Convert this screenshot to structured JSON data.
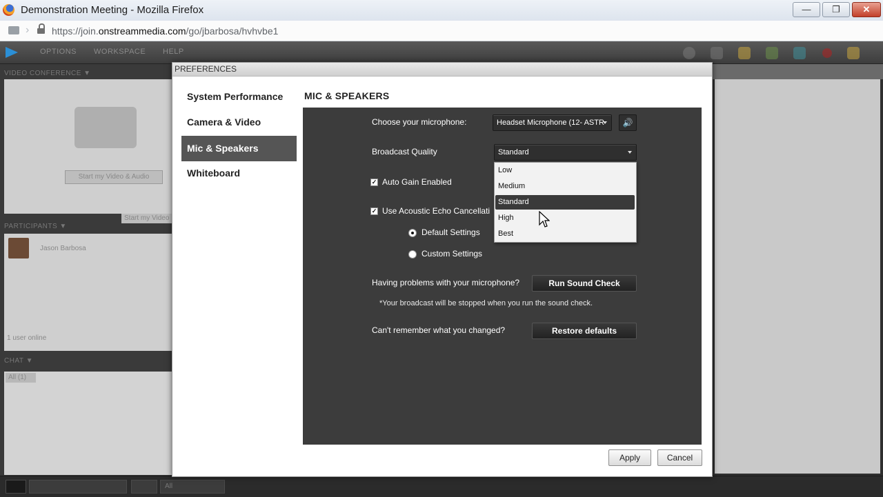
{
  "browser": {
    "window_title": "Demonstration Meeting - Mozilla Firefox",
    "url_prefix": "https://join.",
    "url_domain": "onstreammedia.com",
    "url_path": "/go/jbarbosa/hvhvbe1",
    "minimize_label": "—",
    "restore_label": "❐",
    "close_label": "✕"
  },
  "app": {
    "menu": [
      "OPTIONS",
      "WORKSPACE",
      "HELP"
    ],
    "video_conference_label": "VIDEO CONFERENCE ▼",
    "start_video_label": "Start my Video & Audio",
    "start_video_secondary": "Start my Video",
    "participants_label": "PARTICIPANTS ▼",
    "participant_name": "Jason Barbosa",
    "users_online": "1 user online",
    "chat_label": "CHAT ▼",
    "chat_tab": "All (1)",
    "bottom_select": "All"
  },
  "dialog": {
    "title": "PREFERENCES",
    "nav": [
      {
        "label": "System Performance"
      },
      {
        "label": "Camera & Video"
      },
      {
        "label": "Mic & Speakers"
      },
      {
        "label": "Whiteboard"
      }
    ],
    "active_nav": "Mic & Speakers",
    "section_title": "MIC & SPEAKERS",
    "microphone": {
      "label": "Choose your microphone:",
      "value": "Headset Microphone (12- ASTR"
    },
    "broadcast_quality": {
      "label": "Broadcast Quality",
      "value": "Standard",
      "options": [
        "Low",
        "Medium",
        "Standard",
        "High",
        "Best"
      ],
      "selected": "Standard"
    },
    "auto_gain": {
      "label": "Auto Gain Enabled",
      "checked": true
    },
    "echo_cancel": {
      "label": "Use Acoustic Echo Cancellati",
      "checked": true
    },
    "echo_settings": {
      "default_label": "Default Settings",
      "custom_label": "Custom Settings",
      "selected": "Default Settings"
    },
    "sound_check": {
      "question": "Having problems with your microphone?",
      "button": "Run Sound Check",
      "note": "*Your broadcast will be stopped when you run the sound check."
    },
    "restore": {
      "question": "Can't remember what you changed?",
      "button": "Restore defaults"
    },
    "apply_label": "Apply",
    "cancel_label": "Cancel"
  },
  "colors": {
    "panel_dark": "#3c3c3c",
    "nav_active": "#555555",
    "menu_selected": "#3a3a3a"
  }
}
